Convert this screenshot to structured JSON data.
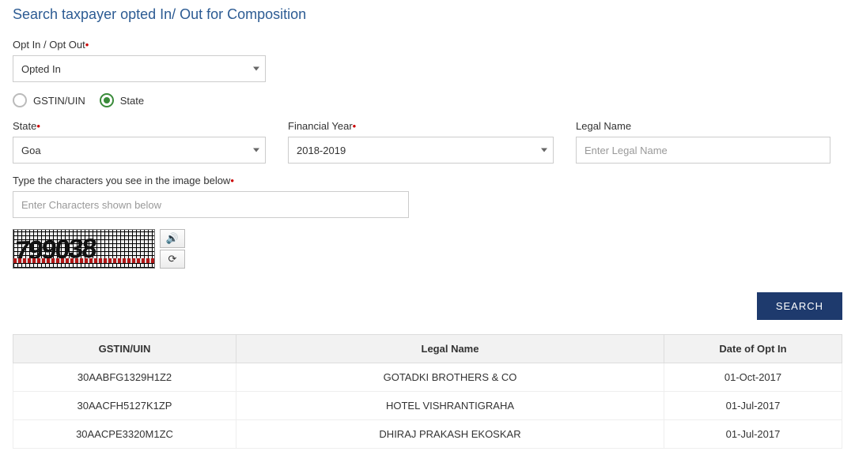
{
  "title": "Search taxpayer opted In/ Out for Composition",
  "optField": {
    "label": "Opt In / Opt Out",
    "value": "Opted In"
  },
  "searchBy": {
    "options": [
      {
        "label": "GSTIN/UIN",
        "checked": false
      },
      {
        "label": "State",
        "checked": true
      }
    ]
  },
  "stateField": {
    "label": "State",
    "value": "Goa"
  },
  "fyField": {
    "label": "Financial Year",
    "value": "2018-2019"
  },
  "legalNameField": {
    "label": "Legal Name",
    "placeholder": "Enter Legal Name"
  },
  "captcha": {
    "label": "Type the characters you see in the image below",
    "placeholder": "Enter Characters shown below",
    "image_text": "799038"
  },
  "buttons": {
    "search": "SEARCH"
  },
  "table": {
    "headers": [
      "GSTIN/UIN",
      "Legal Name",
      "Date of Opt In"
    ],
    "rows": [
      {
        "gstin": "30AABFG1329H1Z2",
        "name": "GOTADKI BROTHERS & CO",
        "date": "01-Oct-2017"
      },
      {
        "gstin": "30AACFH5127K1ZP",
        "name": "HOTEL VISHRANTIGRAHA",
        "date": "01-Jul-2017"
      },
      {
        "gstin": "30AACPE3320M1ZC",
        "name": "DHIRAJ PRAKASH EKOSKAR",
        "date": "01-Jul-2017"
      }
    ]
  }
}
